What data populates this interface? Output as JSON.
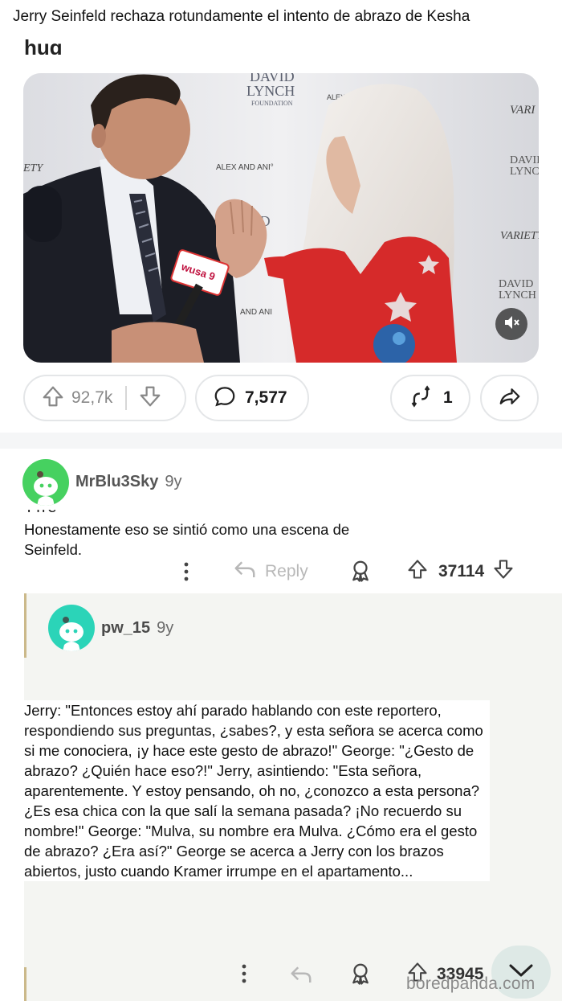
{
  "caption": "Jerry Seinfeld rechaza rotundamente el intento de abrazo de Kesha",
  "cut_title": "hug",
  "post": {
    "upvotes": "92,7k",
    "comments": "7,577",
    "crossposts": "1"
  },
  "comments": [
    {
      "username": "MrBlu3Sky",
      "age": "9y",
      "text": "Honestamente eso se sintió como una escena de Seinfeld.",
      "reply_label": "Reply",
      "votes": "37114",
      "avatar_color": "#46d160"
    },
    {
      "username": "pw_15",
      "age": "9y",
      "text": "Jerry: \"Entonces estoy ahí parado hablando con este reportero, respondiendo sus preguntas, ¿sabes?, y esta señora se acerca como si me conociera, ¡y hace este gesto de abrazo!\" George: \"¿Gesto de abrazo? ¿Quién hace eso?!\" Jerry, asintiendo: \"Esta señora, aparentemente. Y estoy pensando, oh no, ¿conozco a esta persona? ¿Es esa chica con la que salí la semana pasada? ¡No recuerdo su nombre!\" George: \"Mulva, su nombre era Mulva. ¿Cómo era el gesto de abrazo? ¿Era así?\" George se acerca a Jerry con los brazos abiertos, justo cuando Kramer irrumpe en el apartamento...",
      "votes": "33945",
      "avatar_color": "#2bd4b8"
    }
  ],
  "photo": {
    "backdrop_texts": [
      "DAVID LYNCH",
      "FOUNDATION",
      "ALEX AND ANI",
      "Variety",
      "wusa 9"
    ]
  },
  "watermark": "boredpanda.com",
  "icons": [
    "upvote-icon",
    "downvote-icon",
    "comment-icon",
    "crosspost-icon",
    "share-icon",
    "more-icon",
    "reply-icon",
    "award-icon",
    "mute-icon",
    "chevron-down-icon"
  ]
}
